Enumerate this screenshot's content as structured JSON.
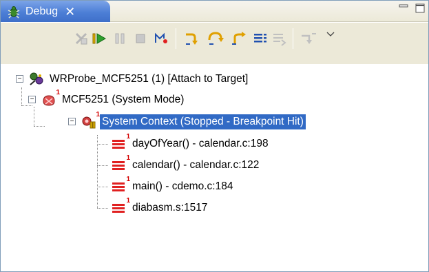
{
  "view": {
    "tab_label": "Debug",
    "tab_close": "✕",
    "tab_icon": "debug-bug-icon",
    "window_controls": [
      "minimize-icon",
      "maximize-icon"
    ]
  },
  "toolbar": {
    "buttons": [
      {
        "name": "remove-launches-icon",
        "enabled": false
      },
      {
        "name": "resume-icon",
        "enabled": true
      },
      {
        "name": "suspend-icon",
        "enabled": false
      },
      {
        "name": "terminate-icon",
        "enabled": false
      },
      {
        "name": "disconnect-icon",
        "enabled": true
      },
      {
        "name": "step-into-icon",
        "enabled": true
      },
      {
        "name": "step-over-icon",
        "enabled": true
      },
      {
        "name": "step-return-icon",
        "enabled": true
      },
      {
        "name": "instruction-step-icon",
        "enabled": true
      },
      {
        "name": "drop-to-frame-icon",
        "enabled": false
      },
      {
        "name": "use-step-filters-icon",
        "enabled": false
      },
      {
        "name": "view-menu-chevron-icon",
        "enabled": true
      }
    ]
  },
  "tree": {
    "target": {
      "label": "WRProbe_MCF5251 (1) [Attach to Target]",
      "expander": "−",
      "icon": "target-connection-icon"
    },
    "core": {
      "label": "MCF5251 (System Mode)",
      "expander": "−",
      "icon": "processor-core-icon",
      "badge": "1"
    },
    "context": {
      "label": "System Context (Stopped - Breakpoint Hit)",
      "expander": "−",
      "icon": "stopped-context-icon",
      "badge": "1",
      "selected": true
    },
    "frames": [
      {
        "label": "dayOfYear() - calendar.c:198",
        "icon": "stack-frame-icon",
        "badge": "1"
      },
      {
        "label": "calendar() - calendar.c:122",
        "icon": "stack-frame-icon",
        "badge": "1"
      },
      {
        "label": "main() - cdemo.c:184",
        "icon": "stack-frame-icon",
        "badge": "1"
      },
      {
        "label": "diabasm.s:1517",
        "icon": "stack-frame-icon",
        "badge": "1"
      }
    ]
  },
  "colors": {
    "tab_blue": "#4d7fd6",
    "selection": "#316ac5",
    "frame_red": "#e02020",
    "toolbar_bg": "#ece9d8"
  }
}
